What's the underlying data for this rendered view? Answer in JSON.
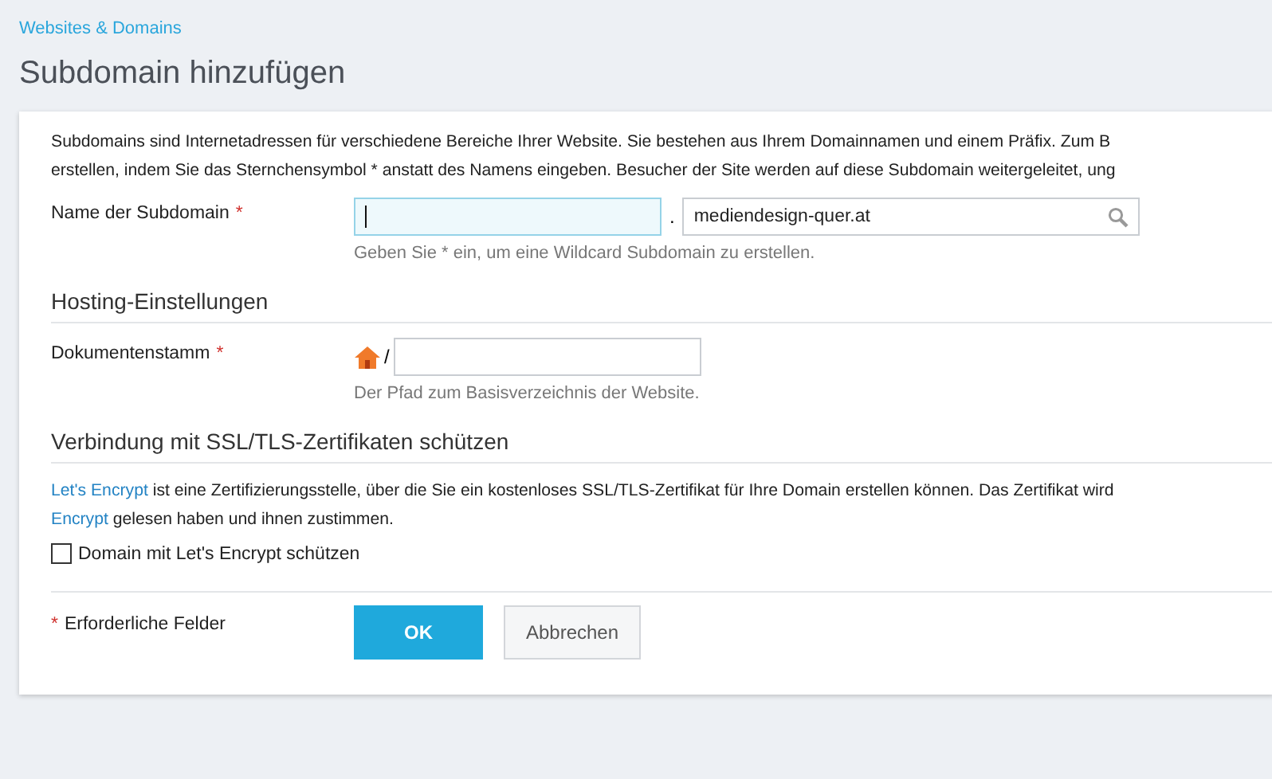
{
  "breadcrumb": "Websites & Domains",
  "title": "Subdomain hinzufügen",
  "intro_lines": [
    "Subdomains sind Internetadressen für verschiedene Bereiche Ihrer Website. Sie bestehen aus Ihrem Domainnamen und einem Präfix. Zum B",
    "erstellen, indem Sie das Sternchensymbol * anstatt des Namens eingeben. Besucher der Site werden auf diese Subdomain weitergeleitet, ung"
  ],
  "subdomain_field": {
    "label": "Name der Subdomain",
    "required": true,
    "separator": ".",
    "domain_value": "mediendesign-quer.at",
    "hint": "Geben Sie * ein, um eine Wildcard Subdomain zu erstellen."
  },
  "hosting": {
    "heading": "Hosting-Einstellungen",
    "label": "Dokumentenstamm",
    "required": true,
    "path_prefix": "/",
    "hint": "Der Pfad zum Basisverzeichnis der Website."
  },
  "ssl": {
    "heading": "Verbindung mit SSL/TLS-Zertifikaten schützen",
    "lines": [
      [
        {
          "text": "Let's Encrypt",
          "link": true
        },
        {
          "text": " ist eine Zertifizierungsstelle, über die Sie ein kostenloses SSL/TLS-Zertifikat für Ihre Domain erstellen können. Das Zertifikat wird",
          "link": false
        }
      ],
      [
        {
          "text": "Encrypt",
          "link": true
        },
        {
          "text": " gelesen haben und ihnen zustimmen.",
          "link": false
        }
      ]
    ],
    "checkbox": {
      "label": "Domain mit Let's Encrypt schützen",
      "checked": false
    }
  },
  "required_note": {
    "mark": "*",
    "text": "Erforderliche Felder"
  },
  "buttons": [
    {
      "label": "OK",
      "kind": "primary"
    },
    {
      "label": "Abbrechen",
      "kind": "secondary"
    }
  ]
}
